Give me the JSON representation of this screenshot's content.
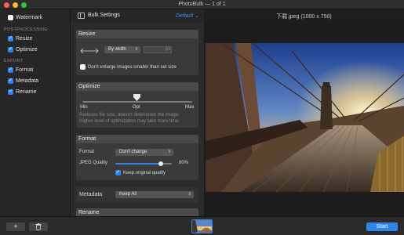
{
  "window": {
    "title": "PhotoBulk — 1 of 1"
  },
  "sidebar": {
    "watermark": {
      "label": "Watermark",
      "checked": false
    },
    "postprocessing_heading": "POSTPROCESSING",
    "post_items": [
      {
        "label": "Resize",
        "checked": true
      },
      {
        "label": "Optimize",
        "checked": true
      }
    ],
    "export_heading": "EXPORT",
    "export_items": [
      {
        "label": "Format",
        "checked": true
      },
      {
        "label": "Metadata",
        "checked": true
      },
      {
        "label": "Rename",
        "checked": true
      }
    ]
  },
  "settings": {
    "title": "Bulk Settings",
    "preset": "Default ⌄",
    "resize": {
      "heading": "Resize",
      "mode": "By width",
      "unit": "px",
      "dont_enlarge_label": "Don't enlarge images smaller than set size",
      "dont_enlarge_checked": false
    },
    "optimize": {
      "heading": "Optimize",
      "min_label": "Min",
      "opt_label": "Opt",
      "max_label": "Max",
      "level": 0.5,
      "desc_line1": "Reduces file size, doesn't deteriorate the image.",
      "desc_line2": "Higher level of optimization may take more time."
    },
    "format": {
      "heading": "Format",
      "format_label": "Format",
      "format_value": "Don't change",
      "quality_label": "JPEG Quality",
      "quality_value": "80%",
      "quality_level": 0.8,
      "keep_quality_label": "Keep original quality",
      "keep_quality_checked": true
    },
    "metadata": {
      "label": "Metadata",
      "value": "Keep All"
    },
    "rename": {
      "heading": "Rename"
    }
  },
  "preview": {
    "title": "下载.jpeg (1000 x 750)"
  },
  "bottom": {
    "add_label": "+",
    "delete_icon": "trash-icon",
    "start_label": "Start"
  },
  "colors": {
    "accent": "#2f86e8"
  }
}
